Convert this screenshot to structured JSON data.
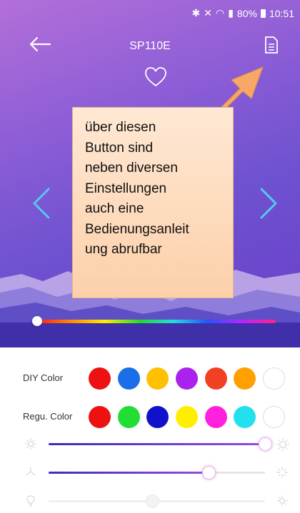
{
  "status": {
    "battery_text": "80%",
    "time": "10:51"
  },
  "header": {
    "title": "SP110E"
  },
  "callout": {
    "lines": [
      "über diesen",
      "Button sind",
      "neben diversen",
      "Einstellungen",
      "auch eine",
      "Bedienungsanleit",
      "ung abrufbar"
    ]
  },
  "hue_slider": {
    "value_fraction": 0.0
  },
  "diy_color": {
    "label": "DIY Color",
    "colors": [
      "#ee1111",
      "#1a6ee8",
      "#ffc000",
      "#aa22ee",
      "#f04122",
      "#ffa000",
      "#ffffff"
    ]
  },
  "regu_color": {
    "label": "Regu. Color",
    "colors": [
      "#ee1111",
      "#22dd33",
      "#1111cc",
      "#ffee00",
      "#ff22dd",
      "#22e0ee",
      "#ffffff"
    ]
  },
  "sliders": {
    "brightness": {
      "value_fraction": 1.0,
      "icon": "sun-icon"
    },
    "speed": {
      "value_fraction": 0.74,
      "icon": "sparkle-icon"
    },
    "third": {
      "value_fraction": 0.48,
      "icon": "bulb-icon"
    }
  },
  "colors": {
    "accent": "#9a4ad8",
    "callout_fill": "#fcd0aa",
    "arrow": "#f7a766"
  }
}
